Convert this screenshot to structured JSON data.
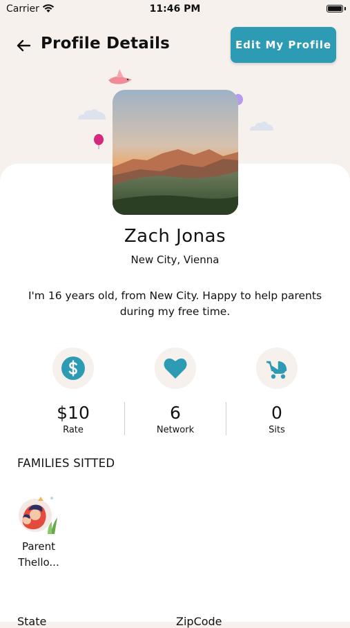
{
  "status_bar": {
    "carrier": "Carrier",
    "time": "11:46 PM"
  },
  "header": {
    "title": "Profile Details",
    "edit_button": "Edit My Profile"
  },
  "profile": {
    "name": "Zach Jonas",
    "location": "New City, Vienna",
    "bio": "I'm 16 years old, from New City. Happy to help parents during my free time."
  },
  "stats": [
    {
      "value": "$10",
      "label": "Rate",
      "icon": "dollar-icon"
    },
    {
      "value": "6",
      "label": "Network",
      "icon": "heart-icon"
    },
    {
      "value": "0",
      "label": "Sits",
      "icon": "stroller-icon"
    }
  ],
  "families": {
    "title": "FAMILIES SITTED",
    "items": [
      {
        "name": "Parent Thello..."
      }
    ]
  },
  "details": {
    "state_label": "State",
    "zipcode_label": "ZipCode"
  },
  "colors": {
    "accent": "#2c9bb3",
    "background": "#f7f1ee",
    "icon_bg": "#f7f1ee"
  }
}
